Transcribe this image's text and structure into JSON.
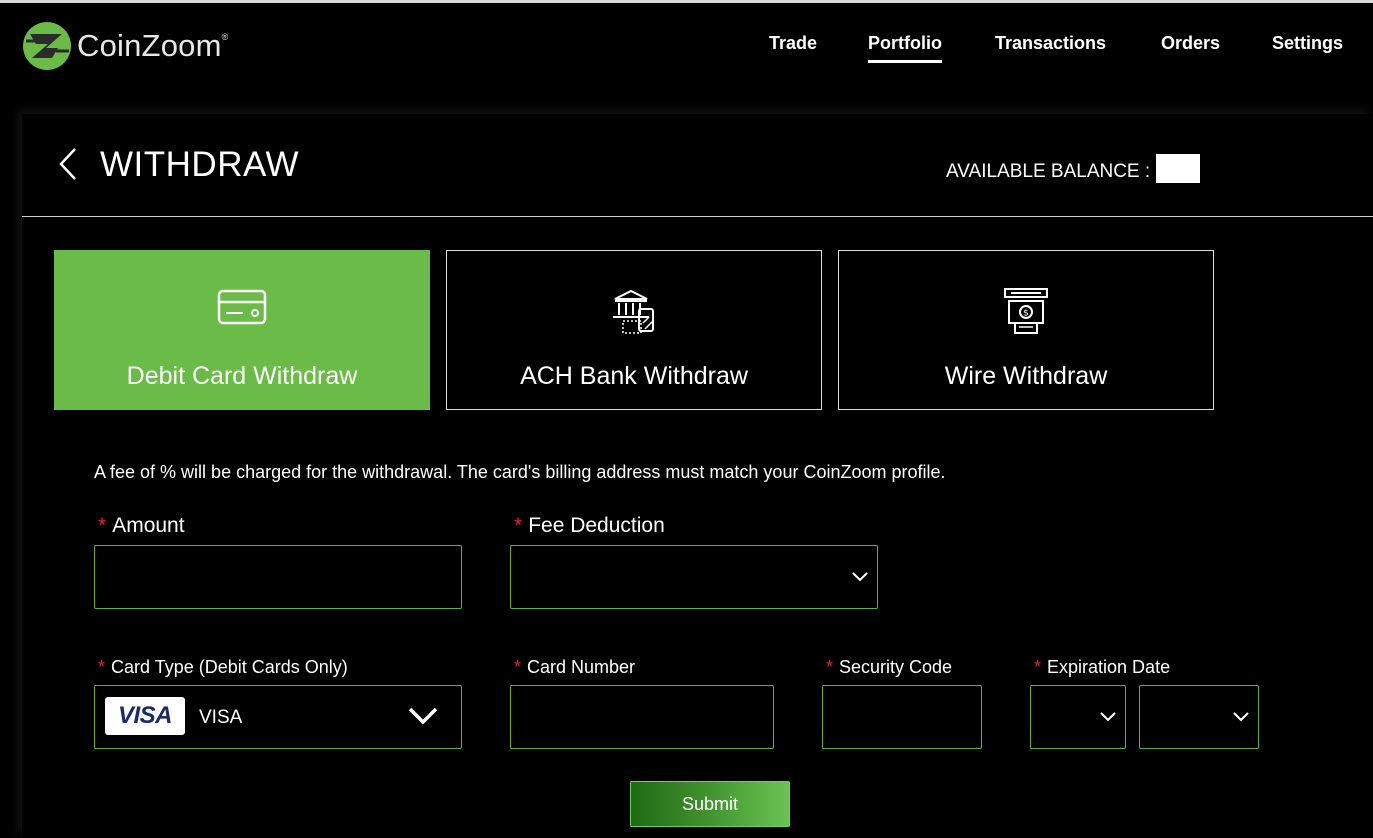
{
  "app": {
    "name": "CoinZoom",
    "trademark": "®"
  },
  "nav": {
    "items": [
      {
        "label": "Trade"
      },
      {
        "label": "Portfolio",
        "active": true
      },
      {
        "label": "Transactions"
      },
      {
        "label": "Orders"
      },
      {
        "label": "Settings"
      }
    ]
  },
  "page": {
    "title": "WITHDRAW",
    "balance_label": "AVAILABLE BALANCE :"
  },
  "methods": [
    {
      "label": "Debit Card Withdraw",
      "icon": "credit-card-icon",
      "active": true
    },
    {
      "label": "ACH Bank Withdraw",
      "icon": "bank-transfer-icon",
      "active": false
    },
    {
      "label": "Wire Withdraw",
      "icon": "cash-withdraw-icon",
      "active": false
    }
  ],
  "form": {
    "fee_note": "A fee of % will be charged for the withdrawal. The card's billing address must match your CoinZoom profile.",
    "required_mark": "*",
    "amount_label": "Amount",
    "fee_deduction_label": "Fee Deduction",
    "card_type_label": "Card Type (Debit Cards Only)",
    "card_type_value": "VISA",
    "card_brand": "VISA",
    "card_number_label": "Card Number",
    "security_code_label": "Security Code",
    "expiration_label": "Expiration Date",
    "submit_label": "Submit"
  },
  "colors": {
    "accent_green": "#6abb47",
    "border_green": "#5fae48",
    "required_red": "#e0262b",
    "background": "#000000"
  }
}
